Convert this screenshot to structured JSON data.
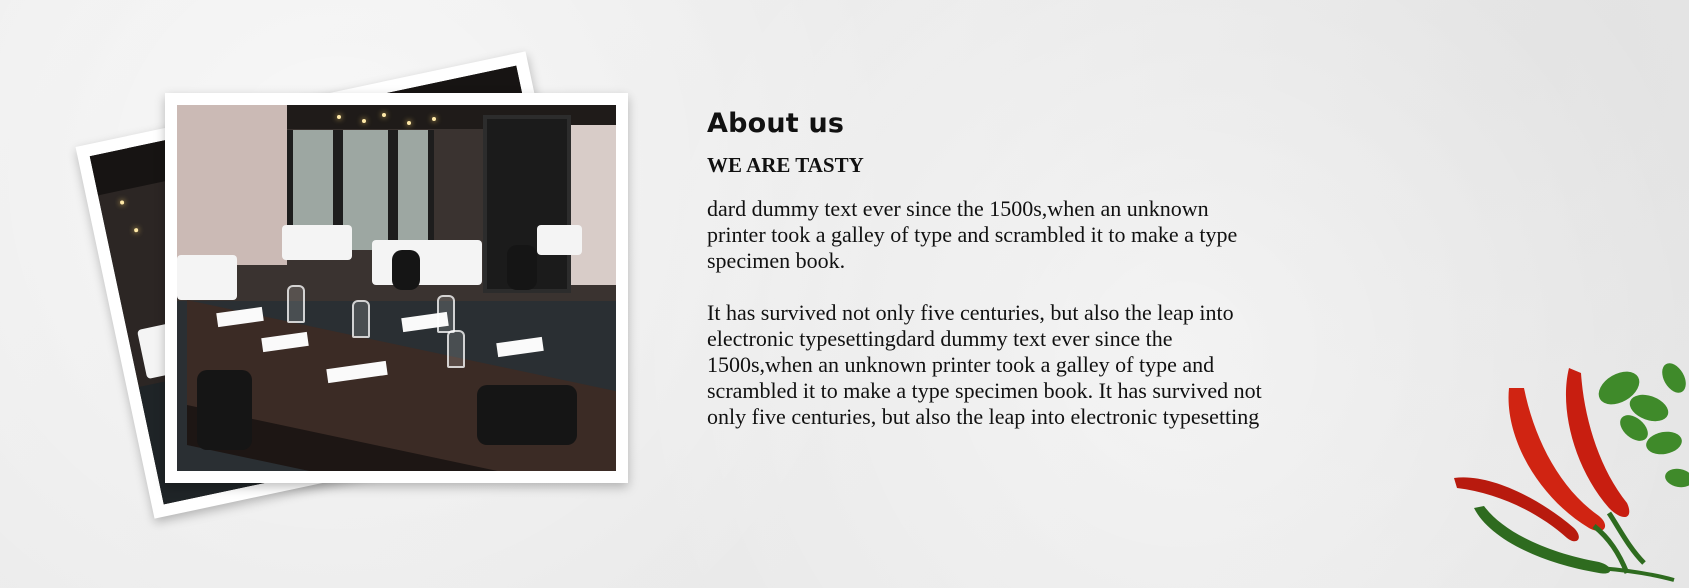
{
  "about": {
    "title": "About us",
    "subtitle": "WE ARE TASTY",
    "paragraphs": [
      "dard dummy text ever since the 1500s,when an unknown printer took a galley of type and scrambled it to make a type specimen book.",
      "It has survived not only five centuries, but also the leap into electronic typesettingdard dummy text ever since the 1500s,when an unknown printer took a galley of type and scrambled it to make a type specimen book. It has survived not only five centuries, but also the leap into electronic typesetting"
    ]
  },
  "images": {
    "front_photo": "restaurant-interior-photo",
    "back_photo": "restaurant-interior-photo",
    "decoration": "chili-peppers-and-herbs"
  },
  "colors": {
    "background": "#ececec",
    "text": "#111111",
    "photo_border": "#ffffff",
    "chili_red": "#c81e10",
    "chili_green": "#2e6b1f"
  }
}
